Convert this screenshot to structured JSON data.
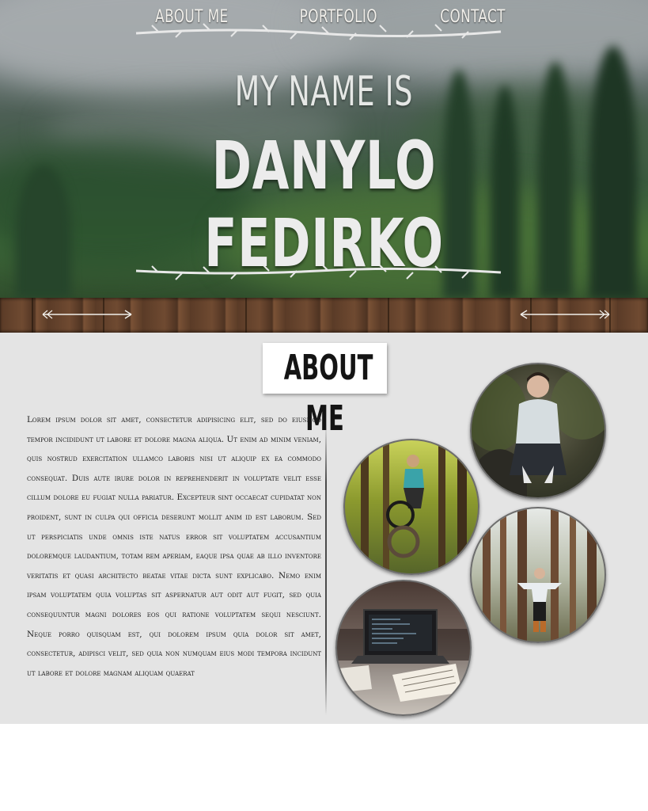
{
  "hero": {
    "subtitle": "MY NAME IS",
    "title": "DANYLO FEDIRKO"
  },
  "nav": {
    "items": [
      {
        "label": "ABOUT ME"
      },
      {
        "label": "PORTFOLIO"
      },
      {
        "label": "CONTACT"
      }
    ]
  },
  "about": {
    "heading": "ABOUT ME",
    "text": "Lorem ipsum dolor sit amet, consectetur adipisicing elit, sed do eiusmod tempor incididunt ut labore et dolore magna aliqua. Ut enim ad minim veniam, quis nostrud exercitation ullamco laboris nisi ut aliquip ex ea commodo consequat. Duis aute irure dolor in reprehenderit in voluptate velit esse cillum dolore eu fugiat nulla pariatur. Excepteur sint occaecat cupidatat non proident, sunt in culpa qui officia deserunt mollit anim id est laborum. Sed ut perspiciatis unde omnis iste natus error sit voluptatem accusantium doloremque laudantium, totam rem aperiam, eaque ipsa quae ab illo inventore veritatis et quasi architecto beatae vitae dicta sunt explicabo. Nemo enim ipsam voluptatem quia voluptas sit aspernatur aut odit aut fugit, sed quia consequuntur magni dolores eos qui ratione voluptatem sequi nesciunt. Neque porro quisquam est, qui dolorem ipsum quia dolor sit amet, consectetur, adipisci velit, sed quia non numquam eius modi tempora incidunt ut labore et dolore magnam aliquam quaerat"
  },
  "photos": [
    {
      "subject": "portrait-photo"
    },
    {
      "subject": "bike-jump-photo"
    },
    {
      "subject": "forest-standing-photo"
    },
    {
      "subject": "laptop-desk-photo"
    }
  ]
}
